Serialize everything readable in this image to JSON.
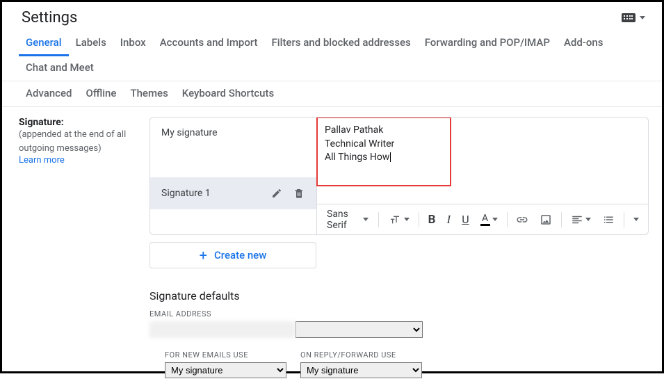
{
  "header": {
    "title": "Settings"
  },
  "tabs_row1": [
    {
      "label": "General",
      "active": true
    },
    {
      "label": "Labels"
    },
    {
      "label": "Inbox"
    },
    {
      "label": "Accounts and Import"
    },
    {
      "label": "Filters and blocked addresses"
    },
    {
      "label": "Forwarding and POP/IMAP"
    },
    {
      "label": "Add-ons"
    },
    {
      "label": "Chat and Meet"
    }
  ],
  "tabs_row2": [
    {
      "label": "Advanced"
    },
    {
      "label": "Offline"
    },
    {
      "label": "Themes"
    },
    {
      "label": "Keyboard Shortcuts"
    }
  ],
  "signature": {
    "label": "Signature:",
    "sub": "(appended at the end of all outgoing messages)",
    "learn": "Learn more",
    "items": [
      {
        "name": "My signature",
        "selected": false
      },
      {
        "name": "Signature 1",
        "selected": true
      }
    ],
    "editor_lines": [
      "Pallav Pathak",
      "Technical Writer",
      "All Things How"
    ],
    "create_new": "Create new",
    "toolbar_font": "Sans Serif"
  },
  "defaults": {
    "title": "Signature defaults",
    "email_label": "EMAIL ADDRESS",
    "new_label": "FOR NEW EMAILS USE",
    "reply_label": "ON REPLY/FORWARD USE",
    "new_value": "My signature",
    "reply_value": "My signature"
  }
}
